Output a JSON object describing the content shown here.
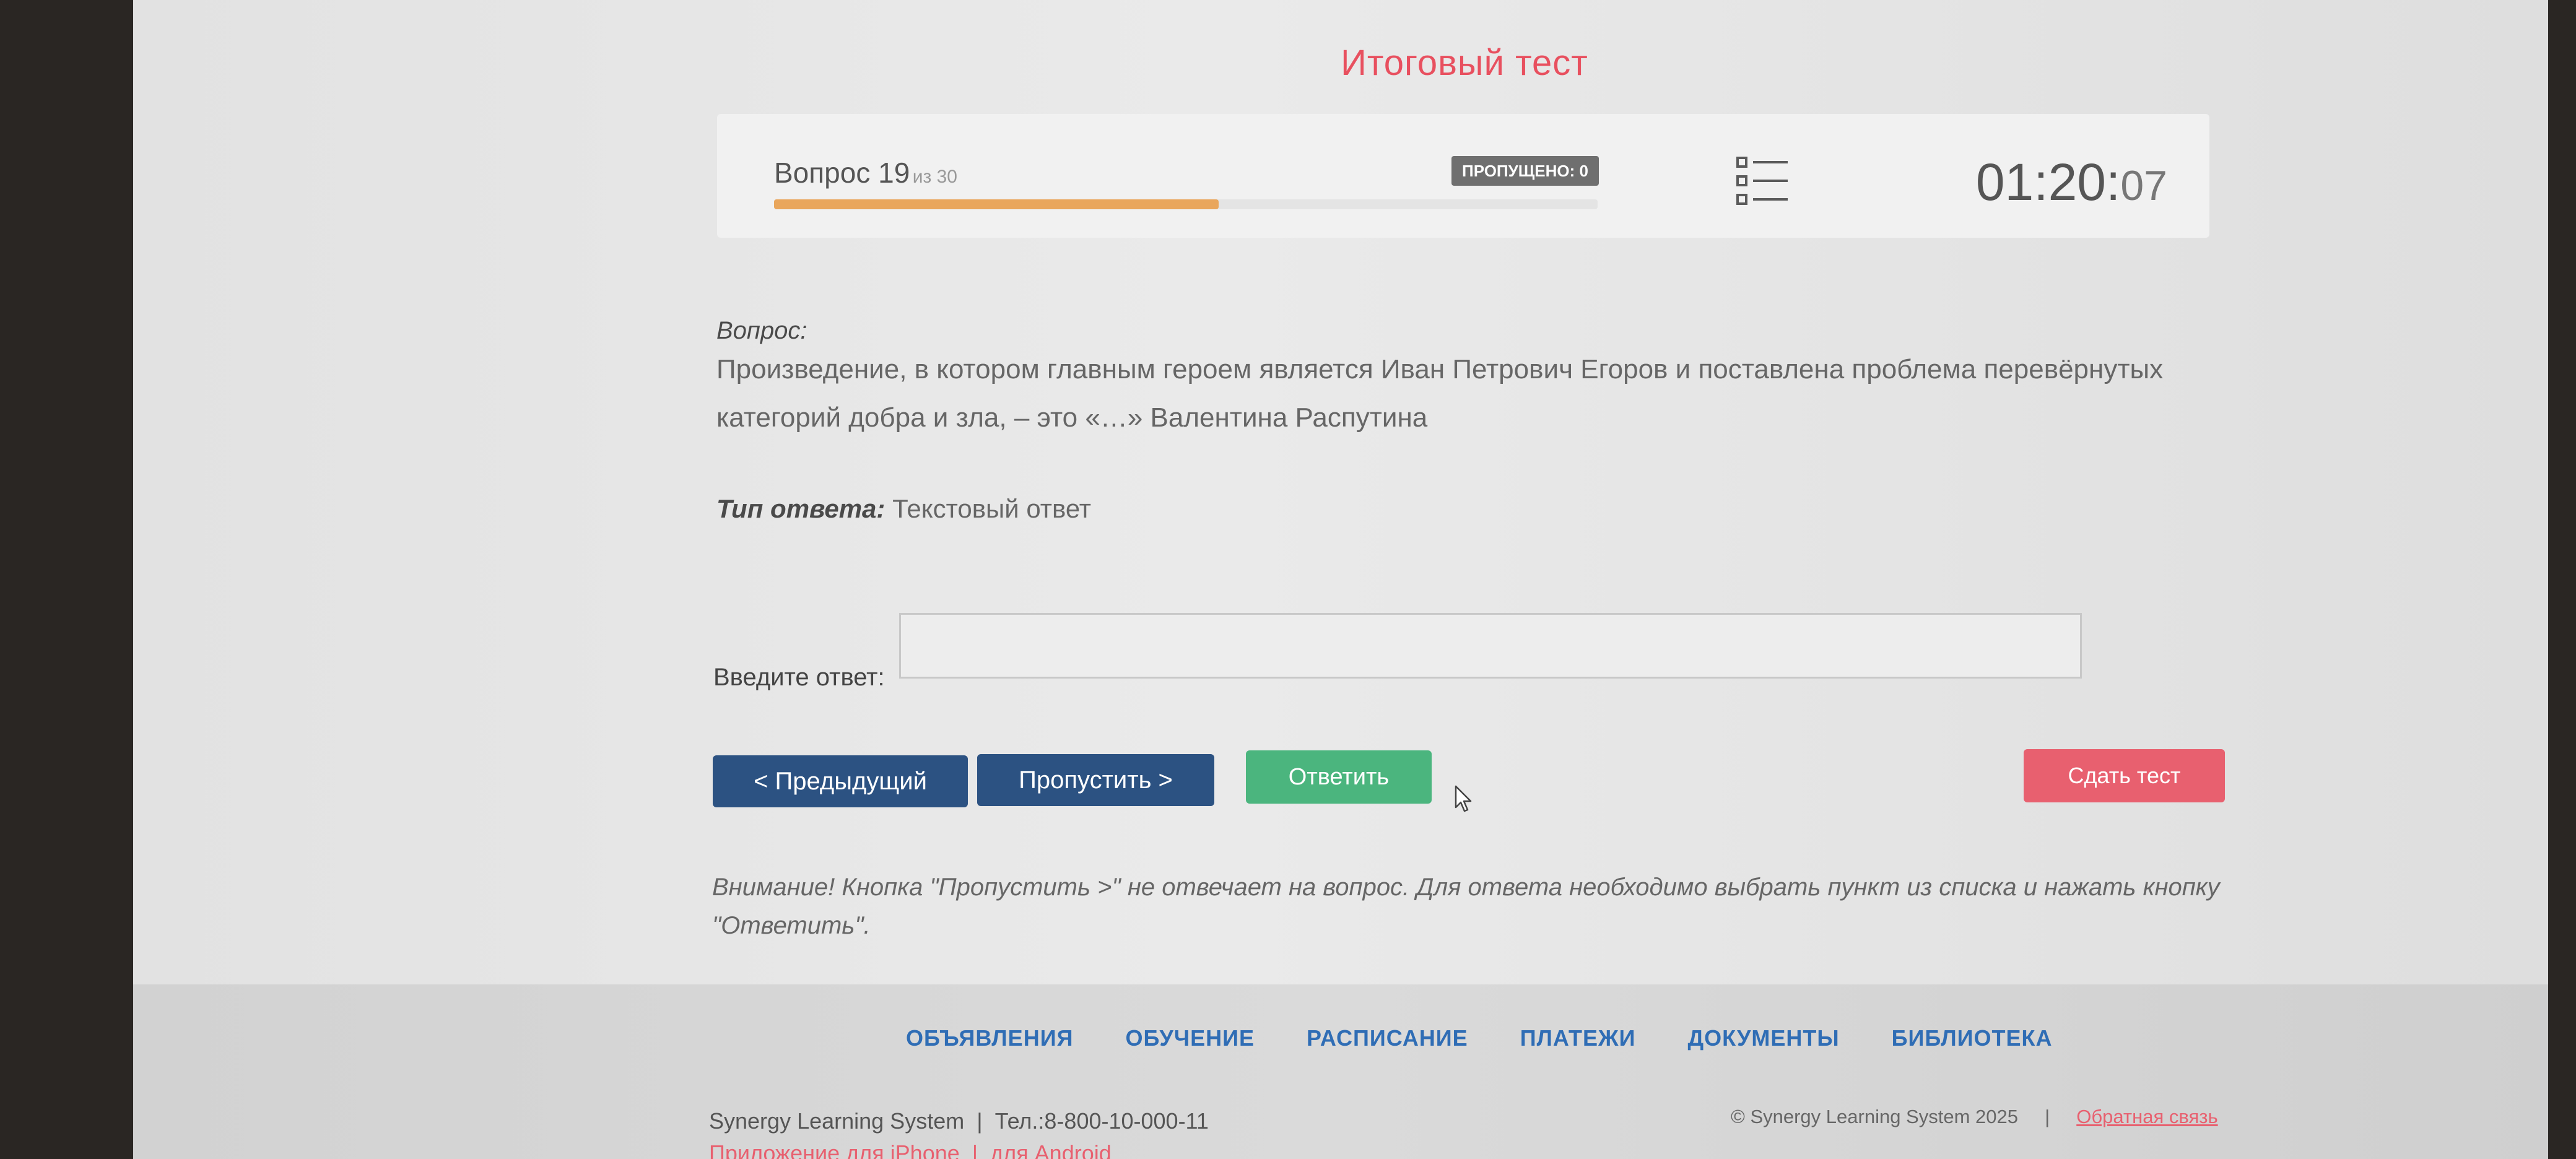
{
  "page": {
    "title": "Итоговый тест"
  },
  "progress": {
    "question_label": "Вопрос",
    "current": "19",
    "total_label": "из 30",
    "completed_fraction": 0.54,
    "skipped_badge": "ПРОПУЩЕНО: 0",
    "timer_hm": "01:20:",
    "timer_s": "07"
  },
  "question": {
    "heading": "Вопрос:",
    "text": "Произведение, в котором главным героем является Иван Петрович Егоров и поставлена проблема перевёрнутых категорий добра и зла, – это «…» Валентина Распутина",
    "answer_type_label": "Тип ответа:",
    "answer_type_value": "Текстовый ответ",
    "answer_prompt": "Введите ответ:",
    "answer_value": ""
  },
  "buttons": {
    "prev": "< Предыдущий",
    "skip": "Пропустить >",
    "answer": "Ответить",
    "submit": "Сдать тест"
  },
  "notice": "Внимание! Кнопка \"Пропустить >\" не отвечает на вопрос. Для ответа необходимо выбрать пункт из списка и нажать кнопку \"Ответить\".",
  "footer": {
    "nav": [
      "ОБЪЯВЛЕНИЯ",
      "ОБУЧЕНИЕ",
      "РАСПИСАНИЕ",
      "ПЛАТЕЖИ",
      "ДОКУМЕНТЫ",
      "БИБЛИОТЕКА"
    ],
    "brand": "Synergy Learning System",
    "phone": "Тел.:8-800-10-000-11",
    "copyright": "© Synergy Learning System 2025",
    "separator": "|",
    "feedback": "Обратная связь",
    "app_iphone": "Приложение для iPhone",
    "app_android": "для Android"
  },
  "colors": {
    "accent": "#e8505f",
    "primary_button": "#2c5282",
    "success_button": "#4bb57e",
    "danger_button": "#e8606f",
    "progress_fill": "#e9a65c",
    "nav_link": "#2f6db5"
  },
  "icons": [
    "question-list-icon",
    "mouse-cursor-icon"
  ]
}
